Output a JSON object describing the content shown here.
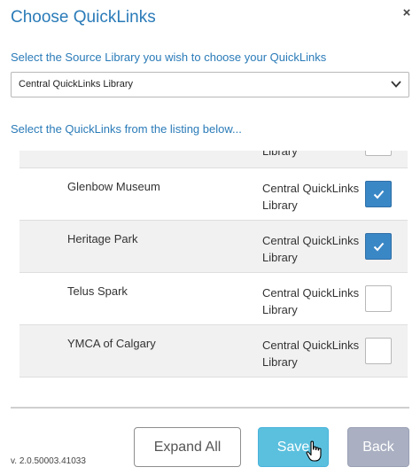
{
  "dialog": {
    "title": "Choose QuickLinks",
    "close_glyph": "×"
  },
  "source": {
    "label": "Select the Source Library you wish to choose your QuickLinks",
    "selected": "Central QuickLinks Library"
  },
  "listing": {
    "label": "Select the QuickLinks from the listing below...",
    "rows": [
      {
        "name": "",
        "library": "Library",
        "checked": false
      },
      {
        "name": "Glenbow Museum",
        "library": "Central QuickLinks Library",
        "checked": true
      },
      {
        "name": "Heritage Park",
        "library": "Central QuickLinks Library",
        "checked": true
      },
      {
        "name": "Telus Spark",
        "library": "Central QuickLinks Library",
        "checked": false
      },
      {
        "name": "YMCA of Calgary",
        "library": "Central QuickLinks Library",
        "checked": false
      }
    ]
  },
  "footer": {
    "version": "v. 2.0.50003.41033",
    "expand_label": "Expand All",
    "save_label": "Save",
    "back_label": "Back"
  },
  "colors": {
    "accent": "#2a7bb8",
    "checkbox_checked": "#3a87c6",
    "save_button": "#5bc0de",
    "back_button": "#aab0c2"
  }
}
